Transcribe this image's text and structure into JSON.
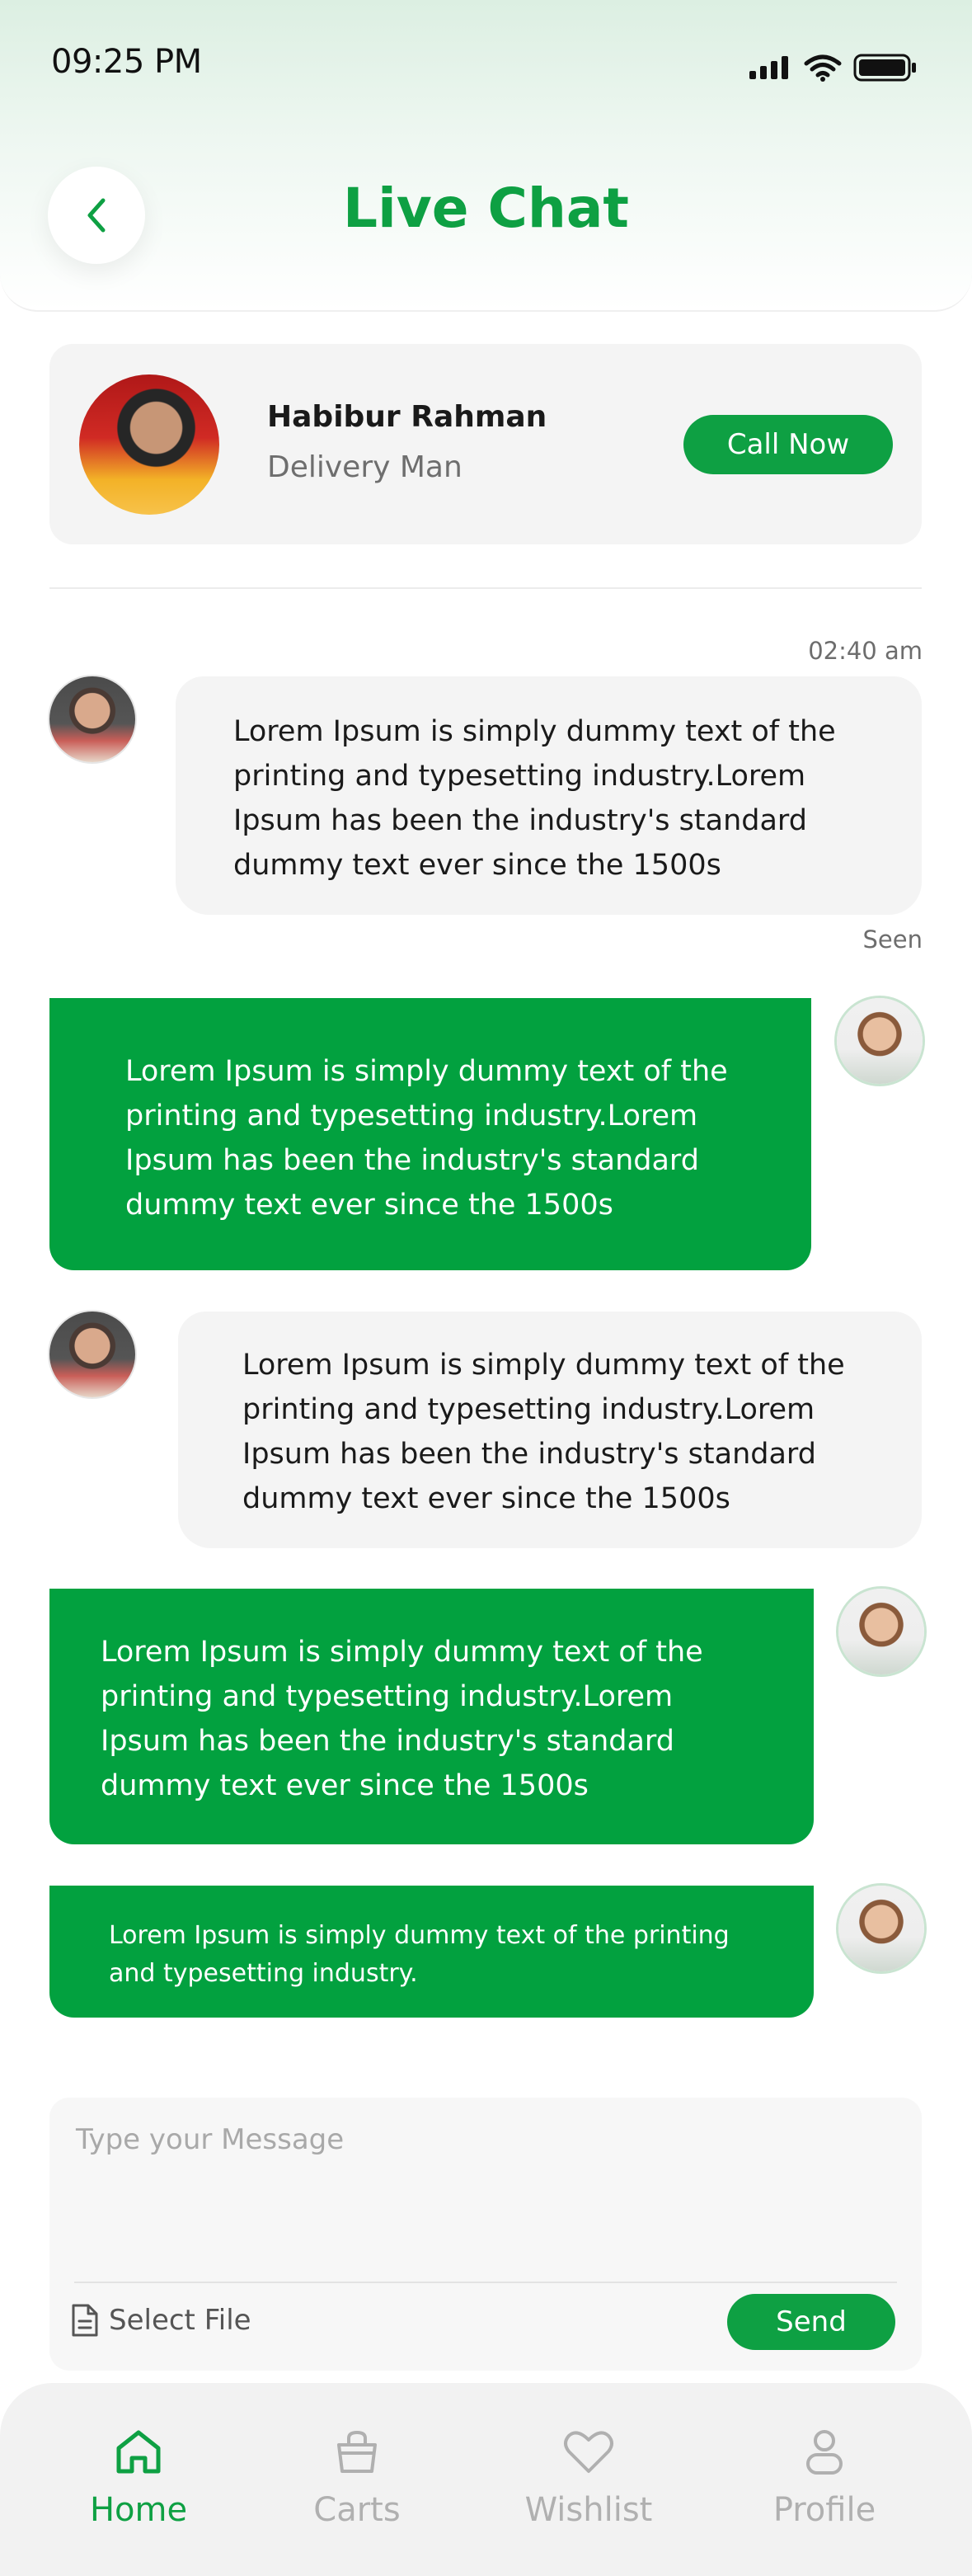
{
  "status_bar": {
    "time": "09:25 PM"
  },
  "header": {
    "title": "Live Chat",
    "back_icon": "chevron-left-icon"
  },
  "contact": {
    "name": "Habibur Rahman",
    "role": "Delivery Man",
    "call_label": "Call Now"
  },
  "chat": {
    "timestamp": "02:40 am",
    "seen_label": "Seen",
    "messages": [
      {
        "direction": "in",
        "text": "Lorem Ipsum is simply dummy text of the\nprinting and typesetting industry.Lorem\nIpsum has been the industry's standard\ndummy text ever since the 1500s"
      },
      {
        "direction": "out",
        "text": "Lorem Ipsum is simply dummy text of the\nprinting and typesetting industry.Lorem\nIpsum has been the industry's standard\ndummy text ever since the 1500s"
      },
      {
        "direction": "in",
        "text": "Lorem Ipsum is simply dummy text of the\nprinting and typesetting industry.Lorem\nIpsum has been the industry's standard\ndummy text ever since the 1500s"
      },
      {
        "direction": "out",
        "text": "Lorem Ipsum is simply dummy text of the\nprinting and typesetting industry.Lorem\nIpsum has been the industry's standard\ndummy text ever since the 1500s"
      },
      {
        "direction": "out",
        "text": "Lorem Ipsum is simply dummy text of the printing\nand typesetting industry."
      }
    ]
  },
  "composer": {
    "placeholder": "Type your Message",
    "select_file_label": "Select File",
    "send_label": "Send"
  },
  "nav": {
    "items": [
      {
        "label": "Home",
        "icon": "home-icon",
        "active": true
      },
      {
        "label": "Carts",
        "icon": "cart-icon",
        "active": false
      },
      {
        "label": "Wishlist",
        "icon": "heart-icon",
        "active": false
      },
      {
        "label": "Profile",
        "icon": "user-icon",
        "active": false
      }
    ]
  },
  "colors": {
    "accent": "#0ea043",
    "bubble_in": "#f4f4f4",
    "bubble_out": "#02a13f",
    "inactive": "#b0b0b0"
  }
}
